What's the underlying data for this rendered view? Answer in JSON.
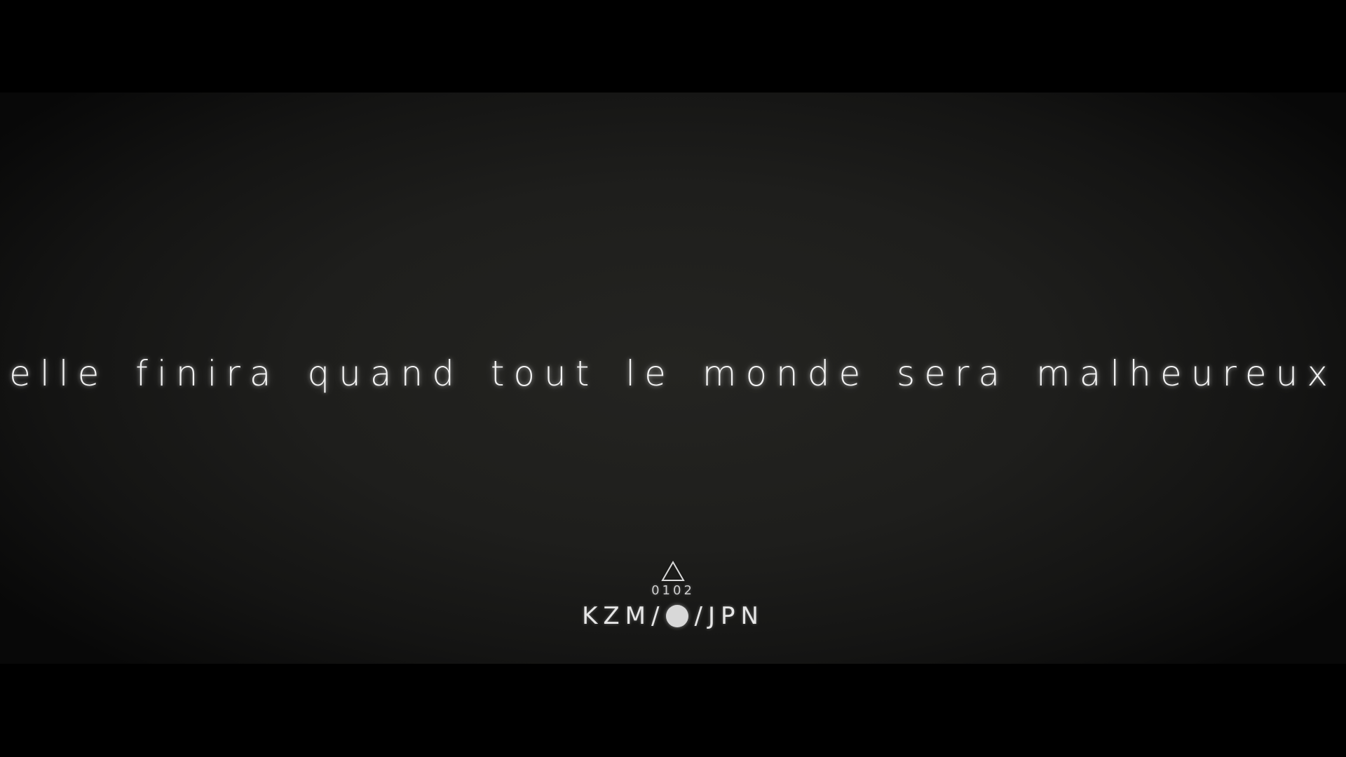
{
  "caption": {
    "text": "elle finira quand tout le monde sera malheureux"
  },
  "logo": {
    "symbol_icon": "triangle-outline-icon",
    "code": "0102",
    "left_text": "KZM/",
    "center_icon": "filled-circle-icon",
    "right_text": "/JPN"
  },
  "colors": {
    "letterbox": "#000000",
    "background": "#232321",
    "text": "#f2f2f2"
  }
}
